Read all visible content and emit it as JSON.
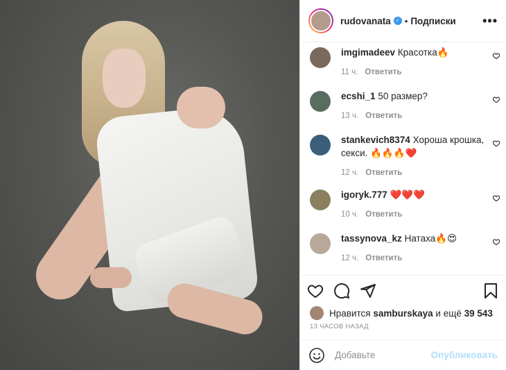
{
  "header": {
    "username": "rudovanata",
    "verified_glyph": "✓",
    "separator": "•",
    "follow_label": "Подписки",
    "more_label": "•••"
  },
  "comments": [
    {
      "user": "imgimadeev",
      "text": "Красотка🔥",
      "time": "11 ч.",
      "reply": "Ответить",
      "avatar_color": "#7a6a5e"
    },
    {
      "user": "ecshi_1",
      "text": "50 размер?",
      "time": "13 ч.",
      "reply": "Ответить",
      "avatar_color": "#5a6b60"
    },
    {
      "user": "stankevich8374",
      "text": "Хороша крошка, секси. 🔥🔥🔥❤️",
      "time": "12 ч.",
      "reply": "Ответить",
      "avatar_color": "#3b5f7a"
    },
    {
      "user": "igoryk.777",
      "text": "❤️❤️❤️",
      "time": "10 ч.",
      "reply": "Ответить",
      "avatar_color": "#8a8060"
    },
    {
      "user": "tassynova_kz",
      "text": "Натаха🔥😍",
      "time": "12 ч.",
      "reply": "Ответить",
      "avatar_color": "#b7a89a"
    }
  ],
  "likes": {
    "prefix": "Нравится",
    "user": "samburskaya",
    "middle": "и ещё",
    "count": "39 543"
  },
  "timestamp": "13 ЧАСОВ НАЗАД",
  "add_comment": {
    "placeholder": "Добавьте",
    "publish_label": "Опубликовать"
  },
  "icons": [
    "heart-icon",
    "comment-icon",
    "share-icon",
    "bookmark-icon",
    "smile-icon",
    "more-icon"
  ]
}
